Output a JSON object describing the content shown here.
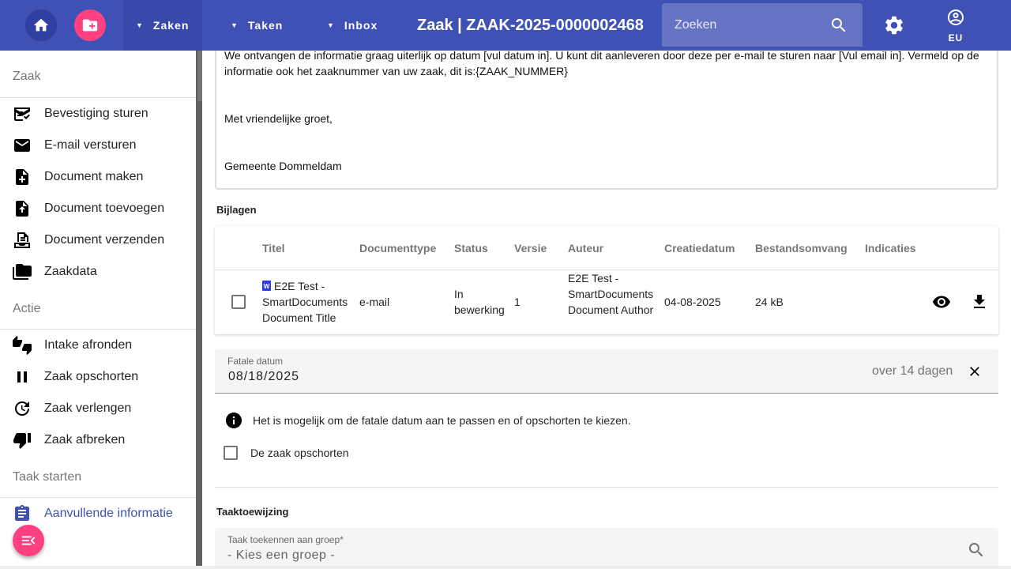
{
  "topbar": {
    "menus": [
      "Zaken",
      "Taken",
      "Inbox"
    ],
    "title": "Zaak | ZAAK-2025-0000002468",
    "search_placeholder": "Zoeken",
    "user_initials": "EU",
    "colors": {
      "primary": "#3f51b5",
      "accent": "#ff4081"
    }
  },
  "sidebar": {
    "sections": [
      {
        "title": "Zaak",
        "items": [
          {
            "label": "Bevestiging sturen",
            "icon": "checklist-icon"
          },
          {
            "label": "E-mail versturen",
            "icon": "mail-icon"
          },
          {
            "label": "Document maken",
            "icon": "note-add-icon"
          },
          {
            "label": "Document toevoegen",
            "icon": "upload-file-icon"
          },
          {
            "label": "Document verzenden",
            "icon": "send-document-icon"
          },
          {
            "label": "Zaakdata",
            "icon": "folder-stack-icon"
          }
        ]
      },
      {
        "title": "Actie",
        "items": [
          {
            "label": "Intake afronden",
            "icon": "thumbs-up-down-icon"
          },
          {
            "label": "Zaak opschorten",
            "icon": "pause-icon"
          },
          {
            "label": "Zaak verlengen",
            "icon": "update-icon"
          },
          {
            "label": "Zaak afbreken",
            "icon": "thumb-down-icon"
          }
        ]
      },
      {
        "title": "Taak starten",
        "items": [
          {
            "label": "Aanvullende informatie",
            "icon": "clipboard-icon"
          }
        ]
      }
    ]
  },
  "email": {
    "paragraph1": "We ontvangen de informatie graag uiterlijk op datum [vul datum in]. U kunt dit aanleveren door deze per e-mail te sturen naar [Vul email in]. Vermeld op de informatie ook het zaaknummer van uw zaak, dit is:{ZAAK_NUMMER}",
    "paragraph2": "Met vriendelijke groet,",
    "paragraph3": "Gemeente Dommeldam"
  },
  "attachments": {
    "label": "Bijlagen",
    "columns": [
      "Titel",
      "Documenttype",
      "Status",
      "Versie",
      "Auteur",
      "Creatiedatum",
      "Bestandsomvang",
      "Indicaties"
    ],
    "rows": [
      {
        "title": "E2E Test - SmartDocuments Document Title",
        "type": "e-mail",
        "status": "In bewerking",
        "version": "1",
        "author": "E2E Test - SmartDocuments Document Author",
        "created": "04-08-2025",
        "size": "24 kB"
      }
    ]
  },
  "deadline": {
    "label": "Fatale datum",
    "value": "08/18/2025",
    "hint": "over 14 dagen",
    "info": "Het is mogelijk om de fatale datum aan te passen en of opschorten te kiezen.",
    "suspend_label": "De zaak opschorten"
  },
  "assignment": {
    "label": "Taaktoewijzing",
    "group_label": "Taak toekennen aan groep*",
    "group_value": "- Kies een groep -"
  }
}
